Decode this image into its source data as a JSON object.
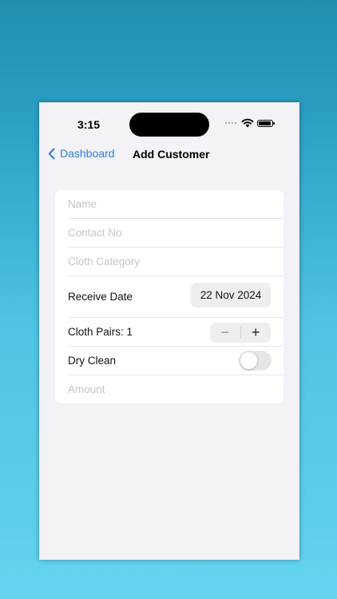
{
  "status_bar": {
    "time": "3:15"
  },
  "nav": {
    "back_label": "Dashboard",
    "title": "Add Customer"
  },
  "form": {
    "name_placeholder": "Name",
    "contact_placeholder": "Contact No",
    "category_placeholder": "Cloth Category",
    "receive_date_label": "Receive Date",
    "receive_date_value": "22 Nov 2024",
    "cloth_pairs_label": "Cloth Pairs: 1",
    "stepper_minus": "−",
    "stepper_plus": "+",
    "dry_clean_label": "Dry Clean",
    "dry_clean_on": false,
    "amount_placeholder": "Amount"
  }
}
